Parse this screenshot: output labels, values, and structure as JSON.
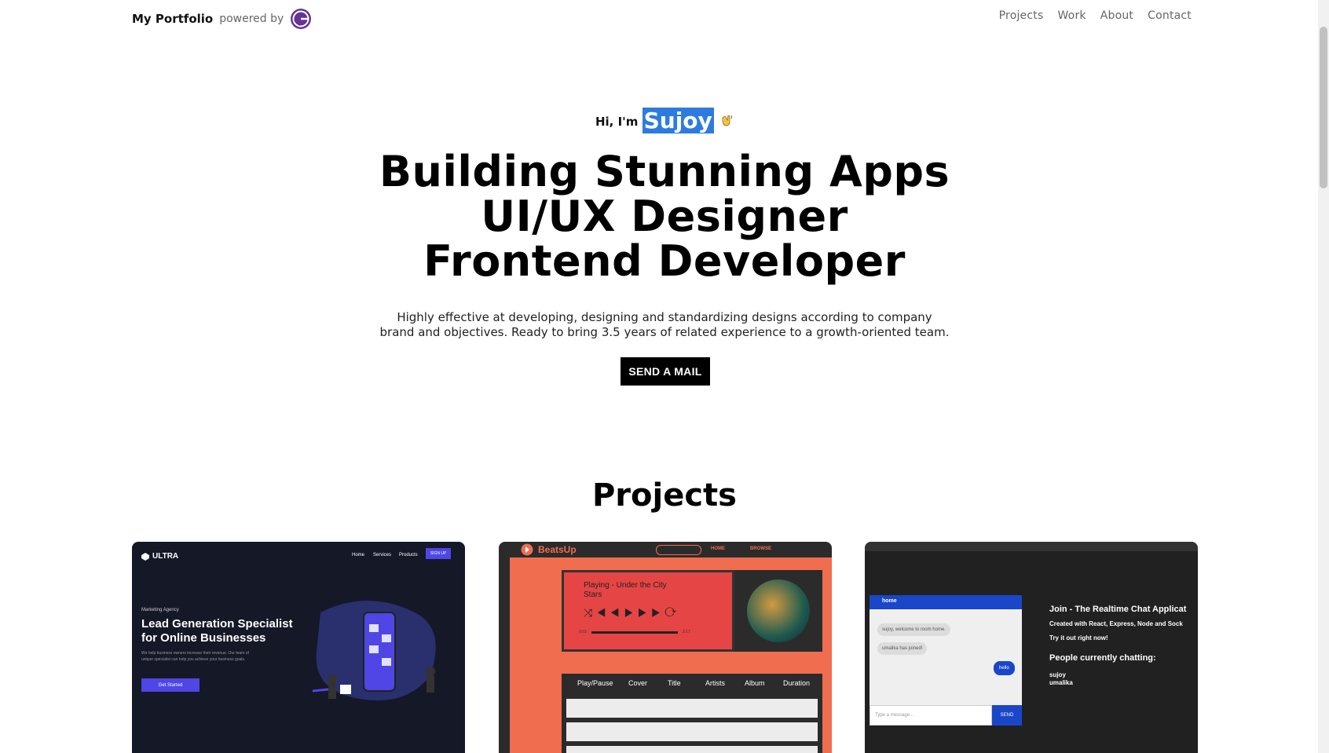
{
  "header": {
    "brand_name": "My Portfolio",
    "brand_powered": "powered by",
    "logo_icon": "gatsby-logo-icon",
    "nav": [
      "Projects",
      "Work",
      "About",
      "Contact"
    ]
  },
  "hero": {
    "greeting_prefix": "Hi, I'm",
    "greeting_name": "Sujoy",
    "greeting_icon": "waving-hand-icon",
    "headline": [
      "Building Stunning Apps",
      "UI/UX Designer",
      "Frontend Developer"
    ],
    "description": [
      "Highly effective at developing, designing and standardizing designs according to company",
      "brand and objectives. Ready to bring 3.5 years of related experience to a growth-oriented team."
    ],
    "cta_label": "SEND A MAIL"
  },
  "projects": {
    "title": "Projects",
    "ultra": {
      "logo": "ULTRA",
      "nav": [
        "Home",
        "Services",
        "Products"
      ],
      "signup": "SIGN UP",
      "eyebrow": "Marketing Agency",
      "heading_1": "Lead Generation Specialist",
      "heading_2": "for Online Businesses",
      "body": "We help business owners increase their revenue. Our team of unique specialist can help you achieve your business goals.",
      "cta": "Get Started"
    },
    "beatsup": {
      "logo": "BeatsUp",
      "nav": [
        "HOME",
        "BROWSE"
      ],
      "now_playing": "Playing - Under the City Stars",
      "time_start": "0:03",
      "time_end": "2:17",
      "table_headers": [
        "Play/Pause",
        "Cover",
        "Title",
        "Artists",
        "Album",
        "Duration"
      ]
    },
    "chat": {
      "room": "home",
      "messages": [
        "sujoy, welcome to room home.",
        "umalika has joined!"
      ],
      "my_message": "hello",
      "placeholder": "Type a message...",
      "send": "SEND",
      "title": "Join - The Realtime Chat Applicat",
      "subtitle": "Created with React, Express, Node and Sock",
      "try_it": "Try it out right now!",
      "people_heading": "People currently chatting:",
      "people": [
        "sujoy",
        "umalika"
      ]
    }
  },
  "colors": {
    "accent_highlight": "#2e7be0",
    "gatsby_purple": "#663399",
    "cta_bg": "#000000",
    "beatsup_orange": "#f06d50",
    "ultra_navy": "#151827",
    "chat_blue": "#1a47c9"
  }
}
